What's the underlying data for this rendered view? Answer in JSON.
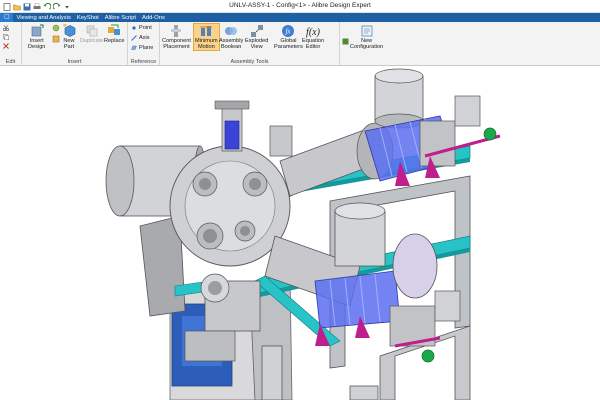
{
  "window": {
    "title": "UNLV-ASSY-1 - Config<1> - Alibre Design Expert"
  },
  "quick_access": [
    {
      "icon": "new-file-icon"
    },
    {
      "icon": "open-folder-icon"
    },
    {
      "icon": "save-icon"
    },
    {
      "icon": "print-icon"
    },
    {
      "icon": "undo-icon"
    },
    {
      "icon": "redo-icon"
    },
    {
      "icon": "dropdown-icon"
    }
  ],
  "menubar": {
    "items": [
      "Viewing and Analysis",
      "KeyShot",
      "Alibre Script",
      "Add-Ons"
    ]
  },
  "ribbon": {
    "groups": {
      "edit": "Edit",
      "insert": "Insert",
      "reference": "Reference",
      "assembly_tools": "Assembly Tools"
    },
    "buttons": {
      "insert_design": "Insert\nDesign",
      "new_part": "New\nPart",
      "duplicate": "Duplicate",
      "replace": "Replace",
      "point": "Point",
      "axis": "Axis",
      "plane": "Plane",
      "component_placement": "Component\nPlacement",
      "minimum_motion": "Minimum\nMotion",
      "assembly_boolean": "Assembly\nBoolean",
      "exploded_view": "Exploded\nView",
      "global_parameters": "Global\nParameters",
      "equation_editor": "Equation\nEditor",
      "new_configuration": "New\nConfiguration"
    }
  },
  "colors": {
    "menubar_bg": "#1f5fa3",
    "active_button": "#f9d38b",
    "frame_cyan": "#27c3c6",
    "pipe_gray": "#c8c8cc",
    "bellows_blue": "#5a6ff0",
    "clamp_magenta": "#c01e8c",
    "handle_green": "#1aa84a"
  }
}
